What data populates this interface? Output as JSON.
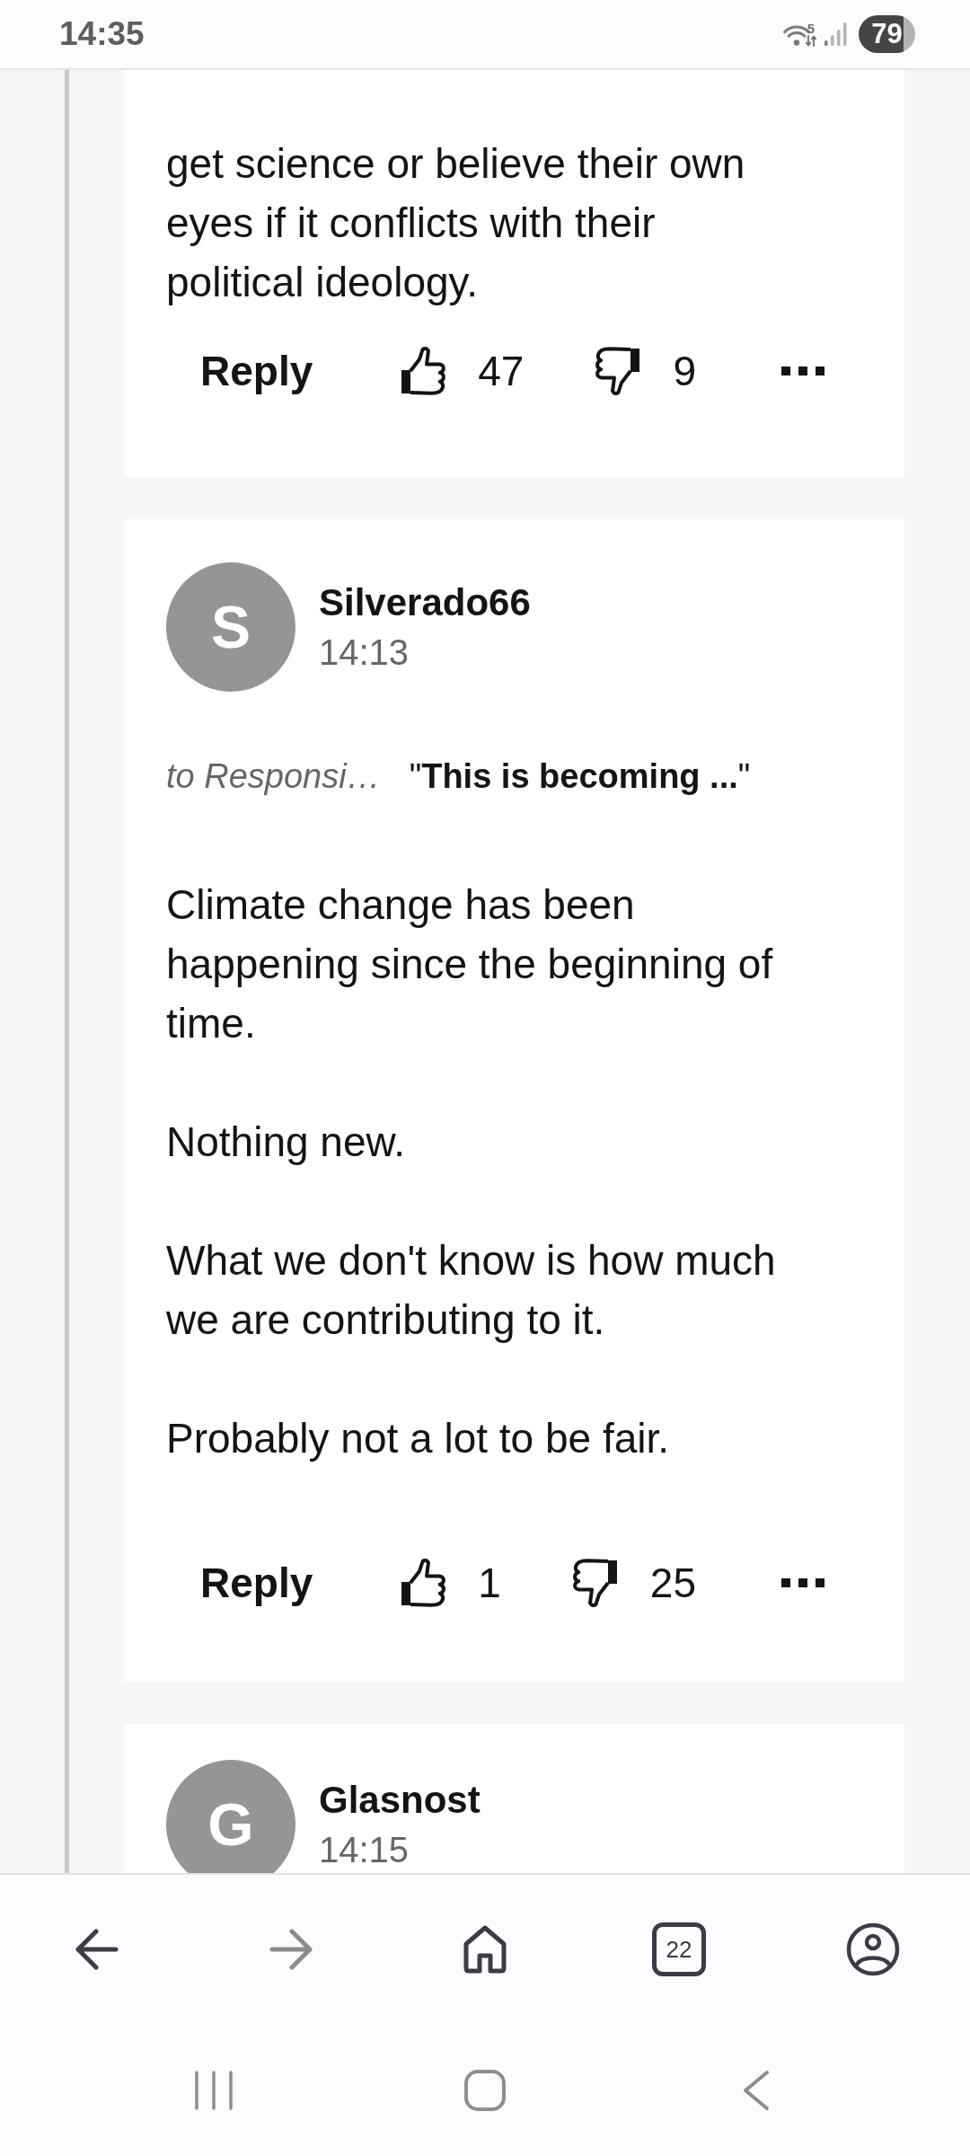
{
  "status_bar": {
    "time": "14:35",
    "wifi_band": "5",
    "battery": "79"
  },
  "comments": [
    {
      "body": [
        "get science or believe their own eyes if it conflicts with their political ideology."
      ],
      "reply": "Reply",
      "likes": "47",
      "dislikes": "9"
    },
    {
      "avatar_letter": "S",
      "author": "Silverado66",
      "time": "14:13",
      "reply_to": {
        "author": "to Responsi…",
        "quote": "\"**This is becoming ...**\""
      },
      "body": [
        "Climate change has been happening since the beginning of time.",
        "Nothing new.",
        "What we don't know is how much we are contributing to it.",
        "Probably not a lot to be fair."
      ],
      "reply": "Reply",
      "likes": "1",
      "dislikes": "25"
    },
    {
      "avatar_letter": "G",
      "author": "Glasnost",
      "time": "14:15"
    }
  ],
  "browser_nav": [
    {
      "kind": "back",
      "disabled": false
    },
    {
      "kind": "forward",
      "disabled": true
    },
    {
      "kind": "home",
      "disabled": false
    },
    {
      "kind": "tabs",
      "count": "22",
      "disabled": false
    },
    {
      "kind": "account",
      "disabled": false
    }
  ],
  "system_nav": [
    {
      "kind": "recents"
    },
    {
      "kind": "home"
    },
    {
      "kind": "back"
    }
  ]
}
